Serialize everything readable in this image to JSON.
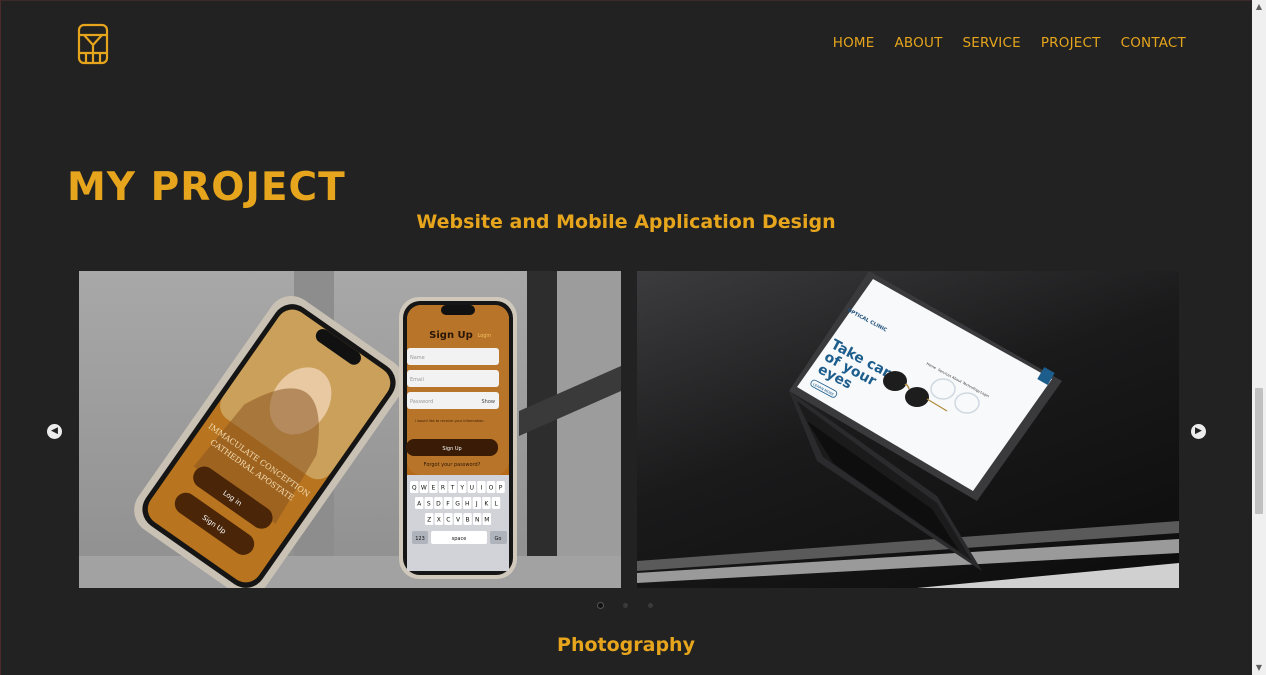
{
  "header": {
    "logo_icon": "monogram-logo-icon",
    "nav": [
      {
        "label": "HOME"
      },
      {
        "label": "ABOUT"
      },
      {
        "label": "SERVICE"
      },
      {
        "label": "PROJECT"
      },
      {
        "label": "CONTACT"
      }
    ]
  },
  "project_section": {
    "title": "MY PROJECT",
    "subtitle": "Website and Mobile Application Design"
  },
  "carousel": {
    "prev_icon": "chevron-left-icon",
    "next_icon": "chevron-right-icon",
    "slides": [
      {
        "phone_left": {
          "line1": "IMMACULATE CONCEPTION",
          "line2": "CATHEDRAL APOSTATE",
          "btn1": "Log in",
          "btn2": "Sign Up"
        },
        "phone_right": {
          "title": "Sign Up",
          "link": "Login",
          "field1": "Name",
          "field2": "Email",
          "field3": "Password",
          "show": "Show",
          "checkbox": "I would like to receive your information.",
          "button": "Sign Up",
          "forgot": "Forgot your password?",
          "key_row1": [
            "Q",
            "W",
            "E",
            "R",
            "T",
            "Y",
            "U",
            "I",
            "O",
            "P"
          ],
          "key_row2": [
            "A",
            "S",
            "D",
            "F",
            "G",
            "H",
            "J",
            "K",
            "L"
          ],
          "key_row3": [
            "Z",
            "X",
            "C",
            "V",
            "B",
            "N",
            "M"
          ],
          "key_123": "123",
          "key_space": "space",
          "key_go": "Go"
        }
      },
      {
        "laptop": {
          "brand": "OPTICAL CLINIC",
          "headline1": "Take care",
          "headline2": "of your",
          "headline3": "eyes",
          "cta": "LEARN MORE",
          "nav": [
            "Home",
            "Services",
            "About",
            "Technology",
            "Login"
          ]
        }
      }
    ],
    "dots": [
      {
        "active": true
      },
      {
        "active": false
      },
      {
        "active": false
      }
    ]
  },
  "photography_section": {
    "title": "Photography"
  },
  "colors": {
    "accent": "#e6a51c",
    "background": "#222222"
  }
}
